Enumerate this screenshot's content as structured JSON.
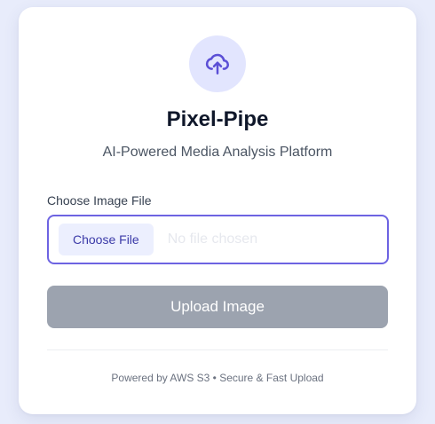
{
  "app": {
    "title": "Pixel-Pipe",
    "subtitle": "AI-Powered Media Analysis Platform",
    "icon": "cloud-upload-icon"
  },
  "form": {
    "file_label": "Choose Image File",
    "choose_button_label": "Choose File",
    "file_status": "No file chosen",
    "upload_button_label": "Upload Image",
    "upload_button_state": "disabled"
  },
  "footer": {
    "text": "Powered by AWS S3 • Secure & Fast Upload"
  },
  "colors": {
    "page_background": "#e8ecfb",
    "accent": "#6d63e2",
    "icon_circle": "#e2e5fe",
    "choose_button_bg": "#eceffe",
    "upload_button_disabled": "#9ca3af",
    "title_text": "#0f172a"
  }
}
